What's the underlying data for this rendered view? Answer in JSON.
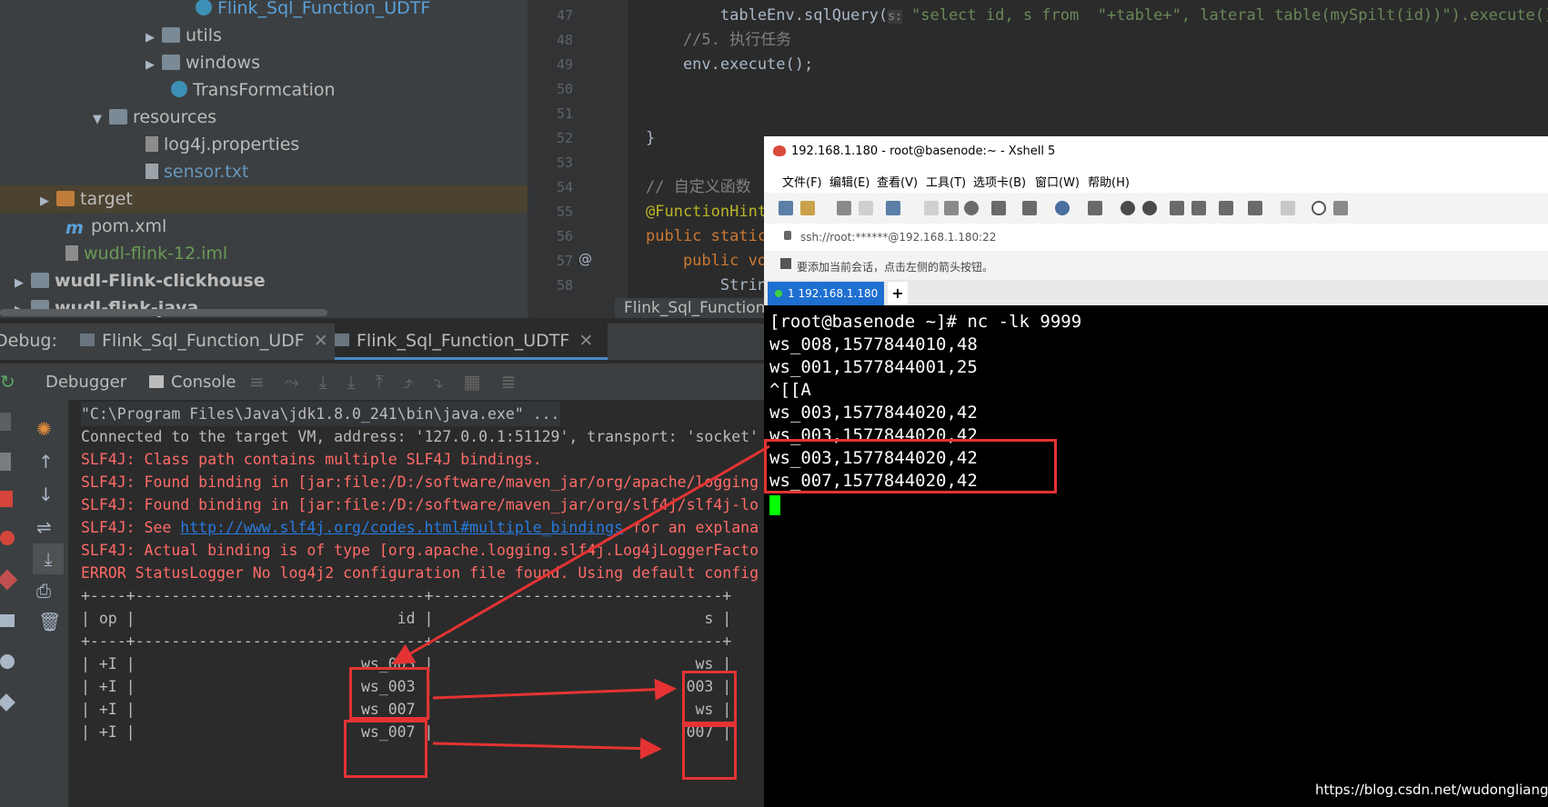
{
  "project_tree": {
    "items": [
      {
        "label": "Flink_Sql_Function_UDTF",
        "icon": "class-icon",
        "indent": "class"
      },
      {
        "label": "utils",
        "icon": "folder-icon"
      },
      {
        "label": "windows",
        "icon": "folder-icon"
      },
      {
        "label": "TransFormcation",
        "icon": "class-icon"
      },
      {
        "label": "resources",
        "icon": "folder-icon"
      },
      {
        "label": "log4j.properties",
        "icon": "properties-icon"
      },
      {
        "label": "sensor.txt",
        "icon": "text-file-icon"
      },
      {
        "label": "target",
        "icon": "folder-icon"
      },
      {
        "label": "pom.xml",
        "icon": "maven-icon"
      },
      {
        "label": "wudl-flink-12.iml",
        "icon": "iml-icon"
      },
      {
        "label": "wudl-Flink-clickhouse",
        "icon": "module-icon"
      },
      {
        "label": "wudl-flink-java",
        "icon": "module-icon"
      }
    ]
  },
  "editor": {
    "line_numbers": [
      "47",
      "48",
      "49",
      "50",
      "51",
      "52",
      "53",
      "54",
      "55",
      "56",
      "57",
      "58"
    ],
    "lines": [
      {
        "pre": "        tableEnv.sqlQuery(",
        "hint": "s:",
        "str": " \"select id, s from  \"",
        "post": "+table+\", lateral table(mySpilt(id))\").execute().p"
      },
      {
        "comment": "    //5. 执行任务"
      },
      {
        "code": "    env.execute();"
      },
      {
        "code": ""
      },
      {
        "code": ""
      },
      {
        "code": "}"
      },
      {
        "code": ""
      },
      {
        "comment": "// 自定义函数"
      },
      {
        "annotation": "@FunctionHint"
      },
      {
        "kw": "public static"
      },
      {
        "kw": "    public vo"
      },
      {
        "code": "        Strin"
      }
    ],
    "tab_label": "Flink_Sql_Function_"
  },
  "debug": {
    "label": "Debug:",
    "tabs": [
      "Flink_Sql_Function_UDF",
      "Flink_Sql_Function_UDTF"
    ],
    "subtabs": {
      "debugger": "Debugger",
      "console": "Console"
    }
  },
  "console": {
    "lines": [
      {
        "text": "\"C:\\Program Files\\Java\\jdk1.8.0_241\\bin\\java.exe\" ...",
        "style": "gray"
      },
      {
        "text": "Connected to the target VM, address: '127.0.0.1:51129', transport: 'socket'",
        "style": "gray"
      },
      {
        "text": "SLF4J: Class path contains multiple SLF4J bindings.",
        "style": "red"
      },
      {
        "text": "SLF4J: Found binding in [jar:file:/D:/software/maven_jar/org/apache/logging",
        "style": "red"
      },
      {
        "text": "SLF4J: Found binding in [jar:file:/D:/software/maven_jar/org/slf4j/slf4j-lo",
        "style": "red"
      },
      {
        "text_pre": "SLF4J: See ",
        "link": "http://www.slf4j.org/codes.html#multiple_bindings",
        "text_post": " for an explana",
        "style": "red"
      },
      {
        "text": "SLF4J: Actual binding is of type [org.apache.logging.slf4j.Log4jLoggerFacto",
        "style": "red"
      },
      {
        "text": "ERROR StatusLogger No log4j2 configuration file found. Using default config",
        "style": "red"
      },
      {
        "text": "+----+--------------------------------+--------------------------------+",
        "style": "gray"
      },
      {
        "text": "| op |                             id |                              s |",
        "style": "gray"
      },
      {
        "text": "+----+--------------------------------+--------------------------------+",
        "style": "gray"
      },
      {
        "text": "| +I |                         ws_003 |                             ws |",
        "style": "gray"
      },
      {
        "text": "| +I |                         ws_003 |                            003 |",
        "style": "gray"
      },
      {
        "text": "| +I |                         ws_007 |                             ws |",
        "style": "gray"
      },
      {
        "text": "| +I |                         ws_007 |                            007 |",
        "style": "gray"
      }
    ]
  },
  "xshell": {
    "title": "192.168.1.180 - root@basenode:~ - Xshell 5",
    "menu": [
      "文件(F)",
      "编辑(E)",
      "查看(V)",
      "工具(T)",
      "选项卡(B)",
      "窗口(W)",
      "帮助(H)"
    ],
    "address": "ssh://root:******@192.168.1.180:22",
    "hint": "要添加当前会话，点击左侧的箭头按钮。",
    "tab": "1 192.168.1.180",
    "terminal_lines": [
      "[root@basenode ~]# nc -lk 9999",
      "ws_008,1577844010,48",
      "ws_001,1577844001,25",
      "^[[A",
      "ws_003,1577844020,42",
      "ws_003,1577844020,42",
      "ws_003,1577844020,42",
      "ws_007,1577844020,42"
    ]
  },
  "watermark": "https://blog.csdn.net/wudonglianga",
  "colors": {
    "annotation_red": "#e53333",
    "cursor_green": "#00ff00"
  }
}
